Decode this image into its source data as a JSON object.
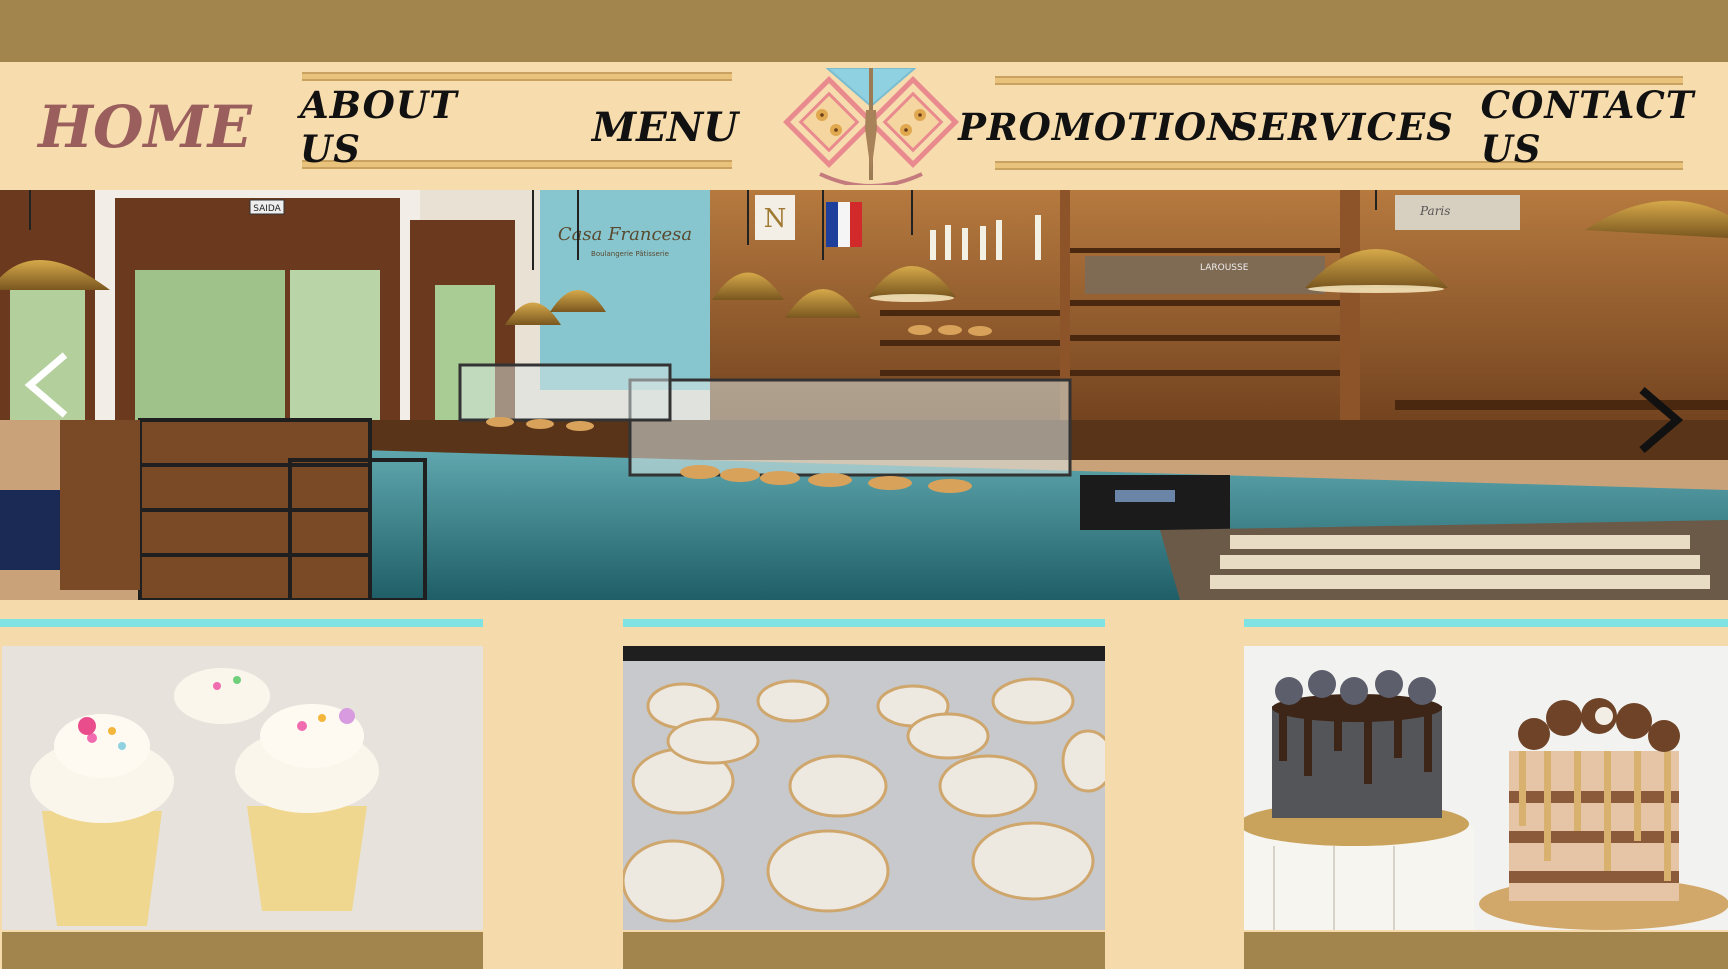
{
  "nav": {
    "home": "HOME",
    "about": "ABOUT US",
    "menu": "MENU",
    "promotion": "PROMOTION",
    "services": "SERVICES",
    "contact": "CONTACT US"
  },
  "hero": {
    "shop_sign": "Casa Francesa",
    "shop_sign_sub": "Boulangerie Pâtisserie",
    "exit_sign": "SAIDA",
    "shelf_label": "LAROUSSE",
    "tin_label": "Paris",
    "logo_letter": "N",
    "prev_icon": "chevron-left-icon",
    "next_icon": "chevron-right-icon"
  },
  "products": [
    {
      "name": "cupcakes"
    },
    {
      "name": "crinkle-cookies"
    },
    {
      "name": "layer-cakes"
    }
  ],
  "colors": {
    "top_bar": "#a2854d",
    "nav_bg": "#f7dcae",
    "page_bg": "#f5dbab",
    "home_accent": "#9a5f5d",
    "cyan_accent": "#7fe3e3",
    "logo_pink": "#e98a8f",
    "logo_blue": "#8fd1e0"
  }
}
